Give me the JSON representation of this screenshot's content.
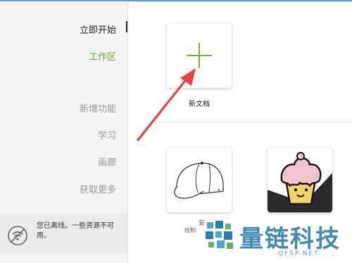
{
  "sidebar": {
    "items": [
      {
        "label": "立即开始"
      },
      {
        "label": "工作区"
      },
      {
        "label": "新增功能"
      },
      {
        "label": "学习"
      },
      {
        "label": "画廊"
      },
      {
        "label": "获取更多"
      }
    ],
    "offline_message": "您已离线。一些资源不可用。"
  },
  "main": {
    "new_document_label": "新文档",
    "thumbnails": [
      {
        "label_main": "安",
        "label_sub": "绘制"
      },
      {
        "label_main": "",
        "label_sub": ""
      }
    ]
  },
  "watermark": {
    "text": "量链科技",
    "sub": "QFSP.NET"
  },
  "colors": {
    "accent_green": "#6aab2d",
    "arrow_red": "#e8413c",
    "watermark_blue": "#2a7fb0"
  },
  "icons": [
    "plus-icon",
    "offline-icon",
    "cap-icon",
    "cupcake-icon"
  ]
}
